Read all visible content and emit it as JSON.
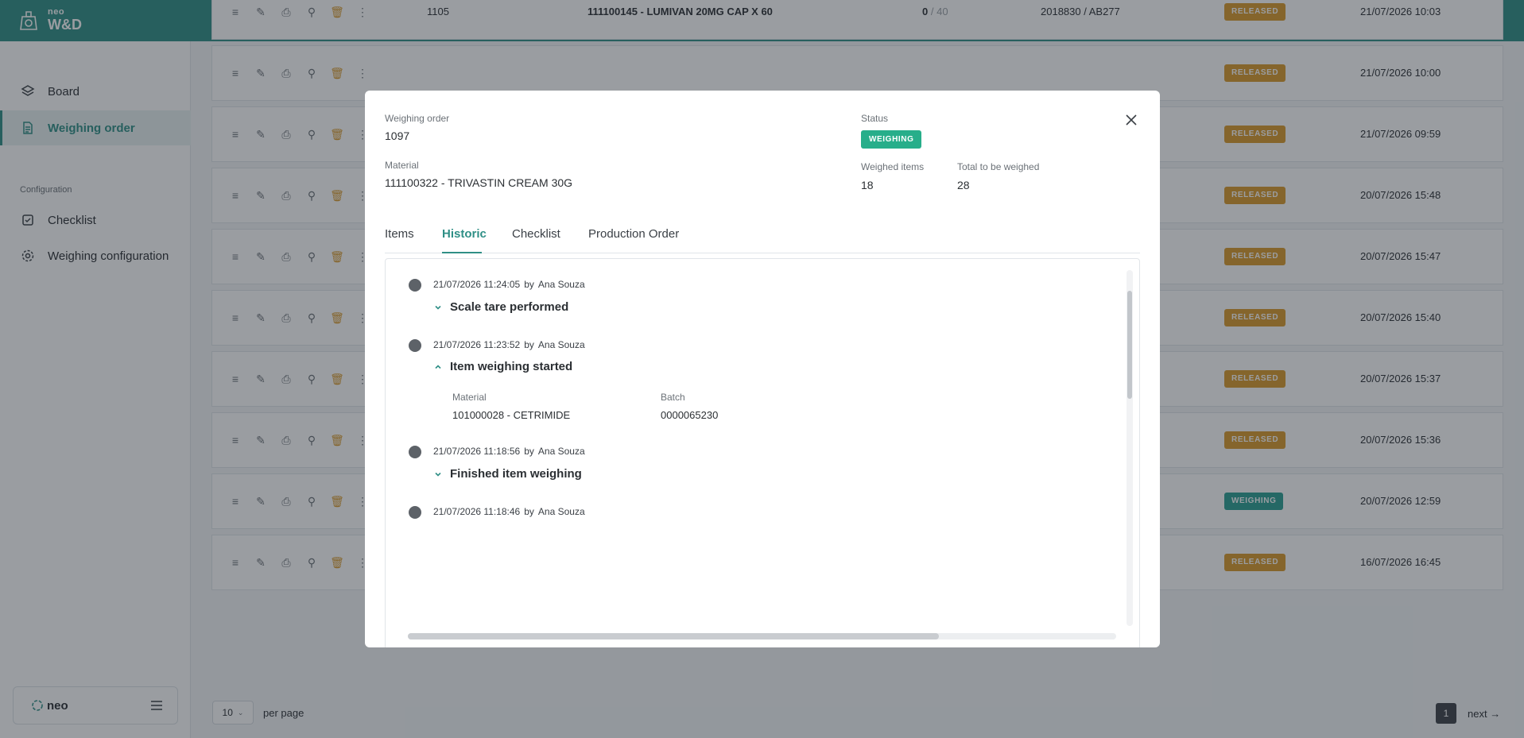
{
  "app": {
    "brand_small": "neo",
    "brand_large": "W&D",
    "footer_brand": "neo"
  },
  "sidebar": {
    "items": [
      {
        "label": "Board",
        "icon": "layers-icon"
      },
      {
        "label": "Weighing order",
        "icon": "document-icon",
        "active": true
      }
    ],
    "section_label": "Configuration",
    "config_items": [
      {
        "label": "Checklist",
        "icon": "checkbox-icon"
      },
      {
        "label": "Weighing configuration",
        "icon": "gear-icon"
      }
    ]
  },
  "table": {
    "first_row": {
      "order": "1105",
      "material": "111100145 - LUMIVAN 20MG CAP X 60",
      "qty_done": "0",
      "qty_total": "/ 40",
      "batch": "2018830 / AB277"
    },
    "rows": [
      {
        "status": "RELEASED",
        "date": "21/07/2026 10:03"
      },
      {
        "status": "RELEASED",
        "date": "21/07/2026 10:00"
      },
      {
        "status": "RELEASED",
        "date": "21/07/2026 09:59"
      },
      {
        "status": "RELEASED",
        "date": "20/07/2026 15:48"
      },
      {
        "status": "RELEASED",
        "date": "20/07/2026 15:47"
      },
      {
        "status": "RELEASED",
        "date": "20/07/2026 15:40"
      },
      {
        "status": "RELEASED",
        "date": "20/07/2026 15:37"
      },
      {
        "status": "RELEASED",
        "date": "20/07/2026 15:36"
      },
      {
        "status": "WEIGHING",
        "date": "20/07/2026 12:59"
      },
      {
        "status": "RELEASED",
        "date": "16/07/2026 16:45"
      }
    ],
    "status_colors": {
      "RELEASED": "#d99a2b",
      "WEIGHING": "#2a9e93"
    }
  },
  "pagination": {
    "per_page_value": "10",
    "per_page_label": "per page",
    "current_page": "1",
    "next_label": "next"
  },
  "modal": {
    "order_label": "Weighing order",
    "order_value": "1097",
    "material_label": "Material",
    "material_value": "111100322 - TRIVASTIN CREAM 30G",
    "status_label": "Status",
    "status_value": "WEIGHING",
    "weighed_label": "Weighed items",
    "weighed_value": "18",
    "total_label": "Total to be weighed",
    "total_value": "28",
    "tabs": [
      "Items",
      "Historic",
      "Checklist",
      "Production Order"
    ],
    "active_tab": "Historic",
    "history": [
      {
        "timestamp": "21/07/2026 11:24:05",
        "by": "by",
        "user": "Ana Souza",
        "title": "Scale tare performed",
        "expanded": false
      },
      {
        "timestamp": "21/07/2026 11:23:52",
        "by": "by",
        "user": "Ana Souza",
        "title": "Item weighing started",
        "expanded": true,
        "details": {
          "material_label": "Material",
          "material_value": "101000028 - CETRIMIDE",
          "batch_label": "Batch",
          "batch_value": "0000065230"
        }
      },
      {
        "timestamp": "21/07/2026 11:18:56",
        "by": "by",
        "user": "Ana Souza",
        "title": "Finished item weighing",
        "expanded": false
      },
      {
        "timestamp": "21/07/2026 11:18:46",
        "by": "by",
        "user": "Ana Souza"
      }
    ]
  },
  "colors": {
    "primary": "#2f8f86",
    "status_weighing": "#27ae8a"
  }
}
